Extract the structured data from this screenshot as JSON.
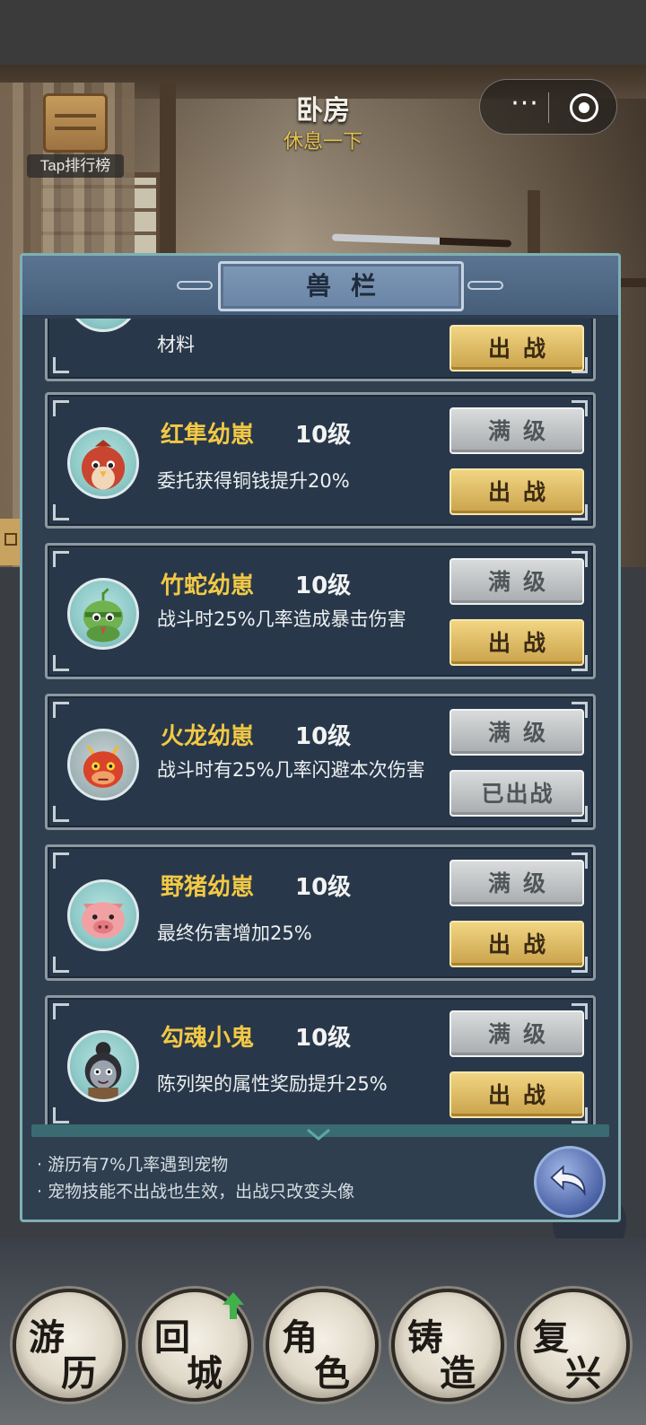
{
  "header": {
    "title": "卧房",
    "subtitle": "休息一下",
    "tap_rank": "Tap排行榜",
    "more_icon": "···"
  },
  "panel": {
    "title": "兽栏",
    "partial_card": {
      "desc": "材料",
      "button": "出战"
    },
    "pets": [
      {
        "name": "红隼幼崽",
        "level": "10级",
        "desc": "委托获得铜钱提升20%",
        "max_label": "满级",
        "action_label": "出战",
        "action_state": "fight",
        "avatar": "red-falcon-avatar"
      },
      {
        "name": "竹蛇幼崽",
        "level": "10级",
        "desc": "战斗时25%几率造成暴击伤害",
        "max_label": "满级",
        "action_label": "出战",
        "action_state": "fight",
        "avatar": "bamboo-snake-avatar"
      },
      {
        "name": "火龙幼崽",
        "level": "10级",
        "desc": "战斗时有25%几率闪避本次伤害",
        "max_label": "满级",
        "action_label": "已出战",
        "action_state": "deployed",
        "avatar": "fire-dragon-avatar"
      },
      {
        "name": "野猪幼崽",
        "level": "10级",
        "desc": "最终伤害增加25%",
        "max_label": "满级",
        "action_label": "出战",
        "action_state": "fight",
        "avatar": "wild-boar-avatar"
      },
      {
        "name": "勾魂小鬼",
        "level": "10级",
        "desc": "陈列架的属性奖励提升25%",
        "max_label": "满级",
        "action_label": "出战",
        "action_state": "fight",
        "avatar": "ghost-imp-avatar"
      }
    ],
    "tips": [
      "· 游历有7%几率遇到宠物",
      "· 宠物技能不出战也生效，出战只改变头像"
    ]
  },
  "nav": [
    {
      "top": "游",
      "bottom": "历"
    },
    {
      "top": "回",
      "bottom": "城"
    },
    {
      "top": "角",
      "bottom": "色"
    },
    {
      "top": "铸",
      "bottom": "造"
    },
    {
      "top": "复",
      "bottom": "兴"
    }
  ],
  "colors": {
    "panel_bg": "#2f3f50",
    "name_gold": "#f2c845",
    "fight_button": "#e4c06a",
    "max_button": "#c4c6c8"
  }
}
